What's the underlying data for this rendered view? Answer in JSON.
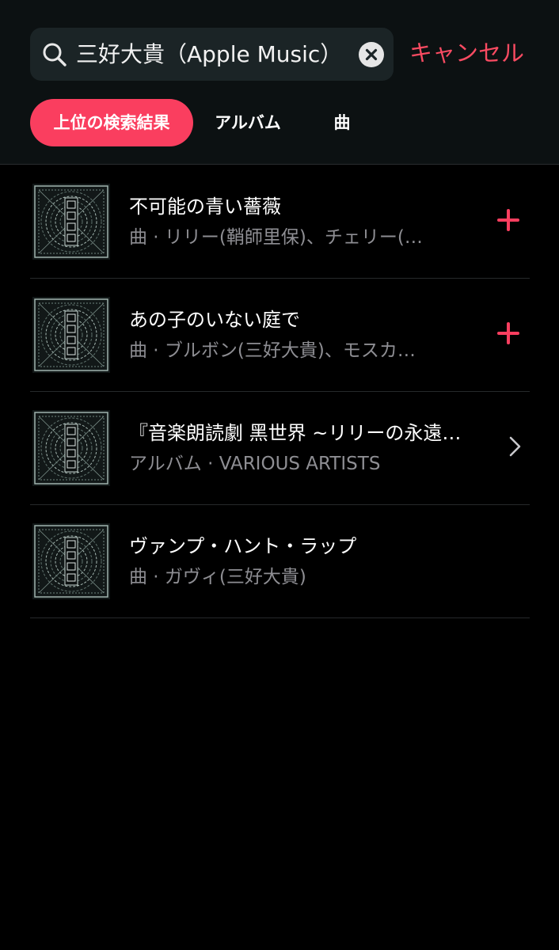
{
  "search": {
    "query": "三好大貴（Apple Music）"
  },
  "header": {
    "cancel_label": "キャンセル"
  },
  "tabs": [
    {
      "label": "上位の検索結果",
      "active": true
    },
    {
      "label": "アルバム",
      "active": false
    },
    {
      "label": "曲",
      "active": false
    }
  ],
  "results": [
    {
      "title": "不可能の青い薔薇",
      "subtitle": "曲 · リリー(鞘師里保)、チェリー(…",
      "action": "plus-icon"
    },
    {
      "title": "あの子のいない庭で",
      "subtitle": "曲 · ブルボン(三好大貴)、モスカ…",
      "action": "plus-icon"
    },
    {
      "title": "『音楽朗読劇 黑世界 ~リリーの永遠…",
      "subtitle": "アルバム · VARIOUS ARTISTS",
      "action": "chevron-right-icon"
    },
    {
      "title": "ヴァンプ・ハント・ラップ",
      "subtitle": "曲 · ガヴィ(三好大貴)",
      "action": "none"
    }
  ],
  "colors": {
    "accent": "#fa3e5f",
    "accent_text": "#fa4b62",
    "background": "#000000",
    "header_background": "#0c1112",
    "secondary_text": "#8e8e93"
  }
}
